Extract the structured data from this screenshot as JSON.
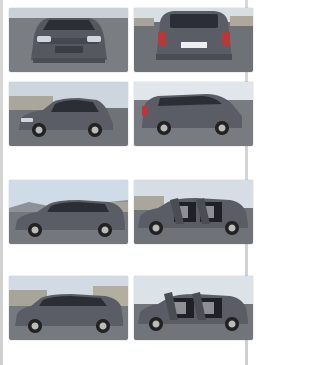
{
  "gallery": {
    "colors": {
      "car": "#5a5d66",
      "car_dark": "#3e4148",
      "glass": "#2b2e35",
      "asphalt": "#6f7276",
      "sky": "#c9d4de",
      "snow": "#e9eef2",
      "building": "#a7a49a",
      "tree": "#6b5e4e"
    },
    "photos": [
      {
        "id": "front",
        "view": "front",
        "icon": "car-front-photo"
      },
      {
        "id": "rear",
        "view": "rear",
        "icon": "car-rear-photo"
      },
      {
        "id": "front-left-3q",
        "view": "three-quarter-front",
        "icon": "car-front-left-photo"
      },
      {
        "id": "rear-left-3q",
        "view": "three-quarter-rear",
        "icon": "car-rear-left-photo"
      },
      {
        "id": "side-left",
        "view": "side",
        "icon": "car-side-photo"
      },
      {
        "id": "doors-open-rear",
        "view": "doors-open",
        "icon": "car-doors-open-photo"
      },
      {
        "id": "side-right",
        "view": "side",
        "icon": "car-side-right-photo"
      },
      {
        "id": "doors-open-front",
        "view": "doors-open",
        "icon": "car-doors-open-front-photo"
      }
    ]
  }
}
